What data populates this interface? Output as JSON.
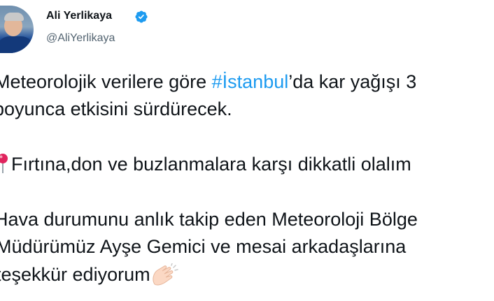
{
  "author": {
    "display_name": "Ali Yerlikaya",
    "handle": "@AliYerlikaya",
    "verified": true
  },
  "tweet": {
    "line1_before": "Meteorolojik verilere göre ",
    "line1_hashtag": "#İstanbul",
    "line1_after": "’da kar yağışı 3",
    "line2": "boyunca etkisini sürdürecek.",
    "line3": "Fırtına,don ve buzlanmalara karşı dikkatli olalım",
    "line4": "Hava durumunu anlık takip eden Meteoroloji Bölge",
    "line5": "Müdürümüz Ayşe Gemici ve mesai arkadaşlarına",
    "line6": "teşekkür ediyorum"
  },
  "icons": {
    "pin": "round-pushpin-icon",
    "clap": "clapping-hands-icon",
    "verified": "verified-badge-icon"
  },
  "colors": {
    "text": "#0f1419",
    "secondary": "#536471",
    "accent": "#1d9bf0"
  }
}
